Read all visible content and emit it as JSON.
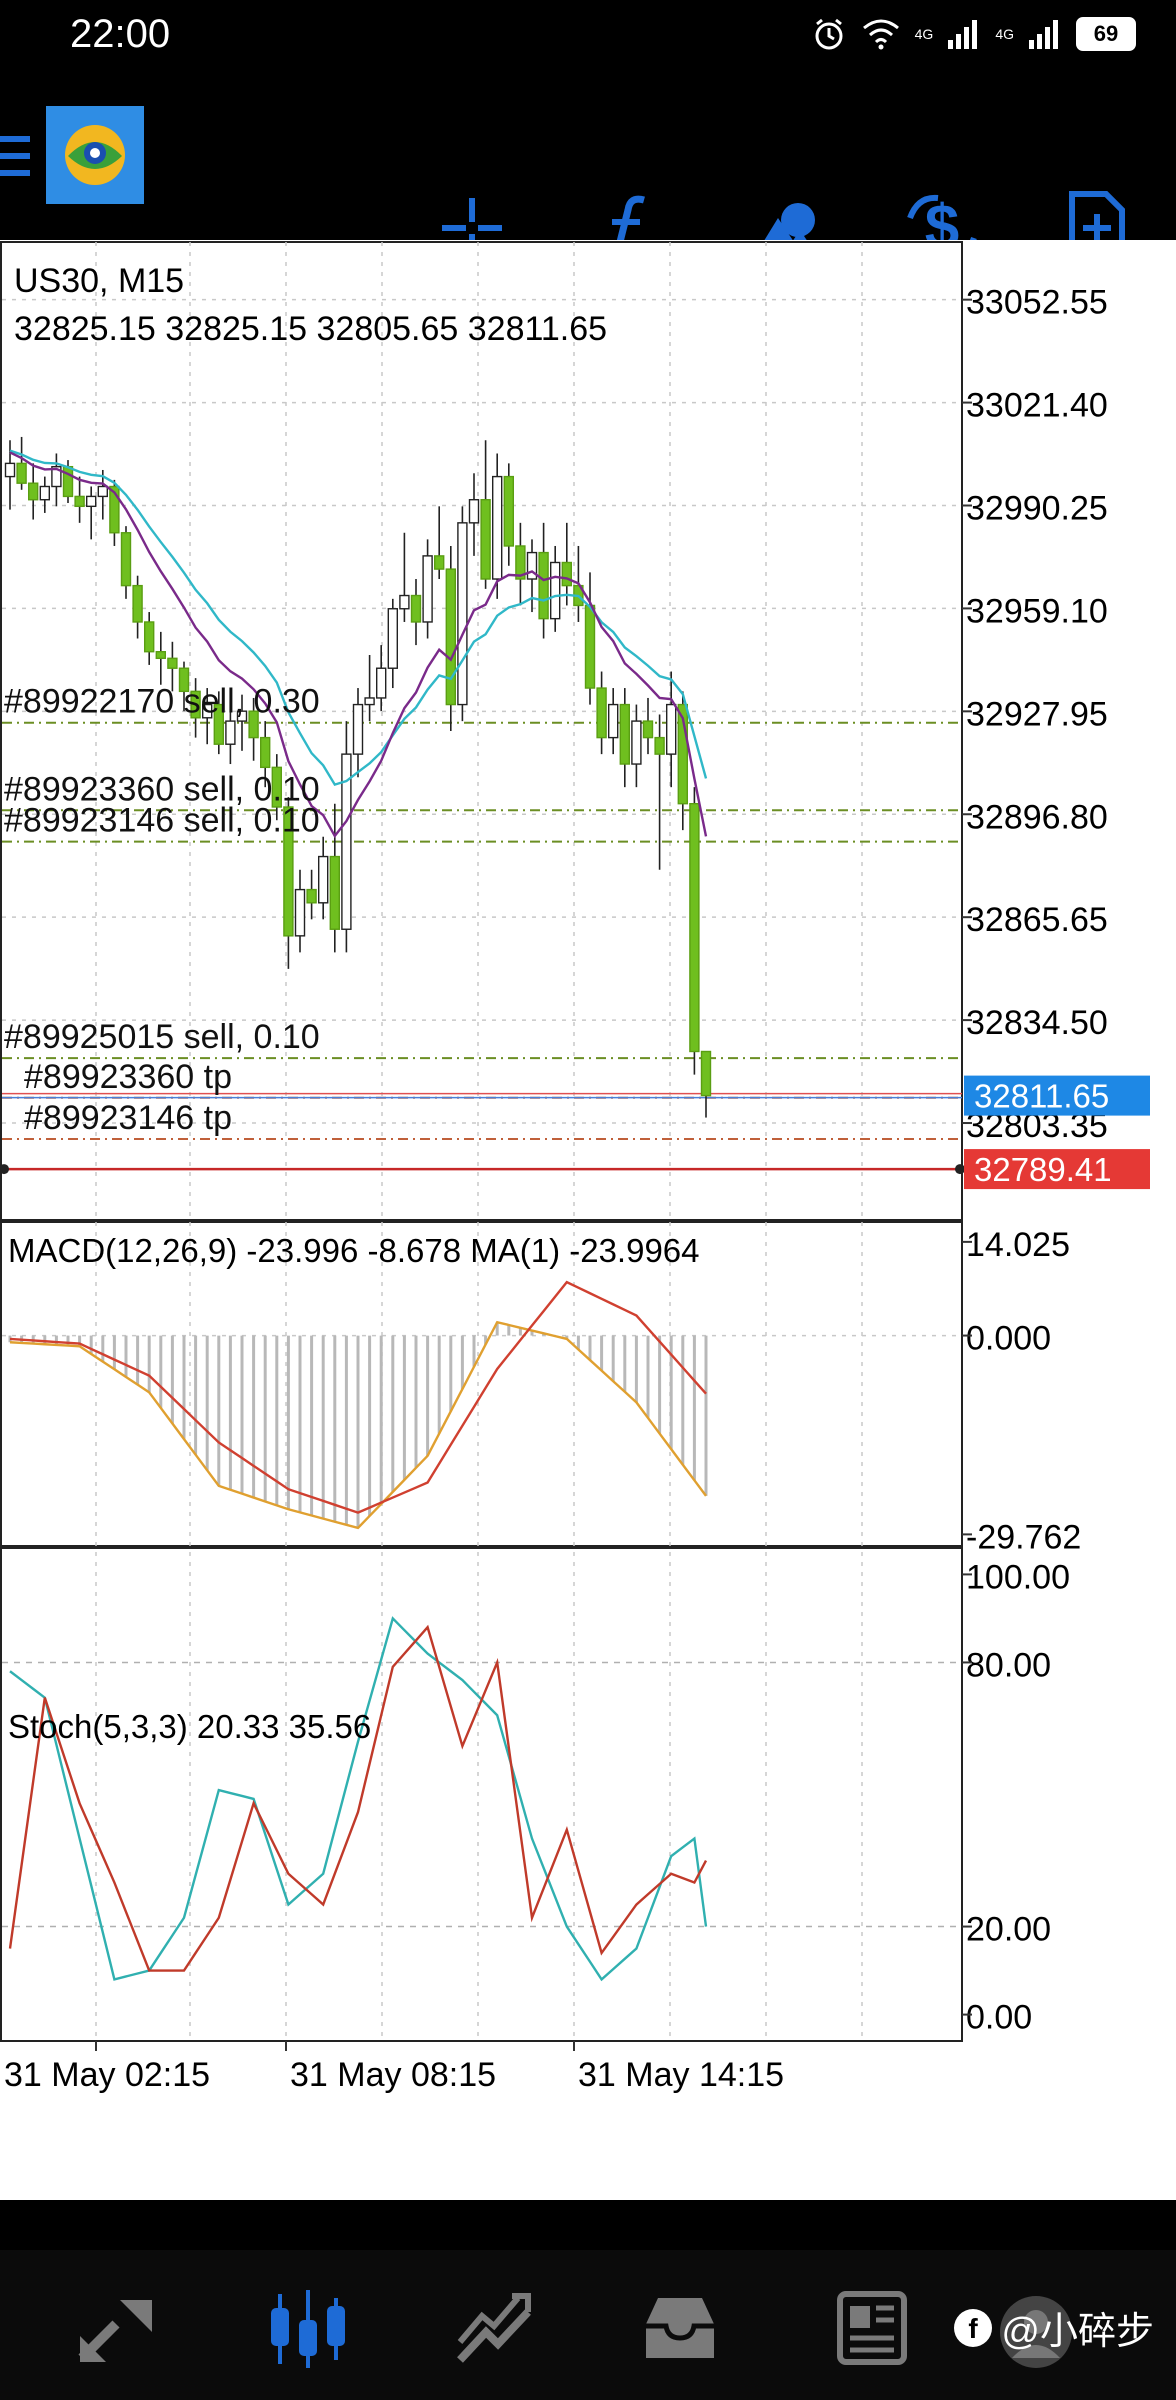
{
  "status": {
    "time": "22:00",
    "battery": "69",
    "net1": "4G",
    "net2": "4G"
  },
  "chart": {
    "symbol_tf": "US30, M15",
    "ohlc": "32825.15 32825.15 32805.65 32811.65"
  },
  "price_axis": [
    "33052.55",
    "33021.40",
    "32990.25",
    "32959.10",
    "32927.95",
    "32896.80",
    "32865.65",
    "32834.50",
    "32803.35"
  ],
  "current_price": {
    "label": "32811.65",
    "color": "#1e88e5"
  },
  "alert_price": {
    "label": "32789.41",
    "color": "#e53935"
  },
  "orders": [
    {
      "label": "#89922170 sell, 0.30",
      "price": 32924.5
    },
    {
      "label": "#89923360 sell, 0.10",
      "price": 32898.0
    },
    {
      "label": "#89923146 sell, 0.10",
      "price": 32888.5
    },
    {
      "label": "#89925015 sell, 0.10",
      "price": 32823.0
    },
    {
      "label": "#89923360 tp",
      "price": 32811.0
    },
    {
      "label": "#89923146 tp",
      "price": 32798.5
    }
  ],
  "macd": {
    "label": "MACD(12,26,9) -23.996 -8.678 MA(1) -23.9964",
    "axis": [
      "14.025",
      "0.000",
      "-29.762"
    ]
  },
  "stoch": {
    "label": "Stoch(5,3,3) 20.33 35.56",
    "axis": [
      "100.00",
      "80.00",
      "20.00",
      "0.00"
    ]
  },
  "time_axis": [
    "31 May 02:15",
    "31 May 08:15",
    "31 May 14:15"
  ],
  "watermark": "@小碎步",
  "chart_data": [
    {
      "type": "candlestick",
      "title": "US30, M15",
      "ylim": [
        32774,
        33070
      ],
      "candles": [
        [
          32999,
          33010,
          32989,
          33003
        ],
        [
          33003,
          33011,
          32995,
          32997
        ],
        [
          32997,
          33003,
          32986,
          32992
        ],
        [
          32992,
          32999,
          32988,
          32996
        ],
        [
          32996,
          33006,
          32990,
          33002
        ],
        [
          33002,
          33004,
          32991,
          32993
        ],
        [
          32993,
          32999,
          32985,
          32990
        ],
        [
          32990,
          32996,
          32980,
          32993
        ],
        [
          32993,
          33001,
          32986,
          32996
        ],
        [
          32996,
          32998,
          32978,
          32982
        ],
        [
          32982,
          32984,
          32962,
          32966
        ],
        [
          32966,
          32969,
          32950,
          32955
        ],
        [
          32955,
          32958,
          32942,
          32946
        ],
        [
          32946,
          32952,
          32936,
          32944
        ],
        [
          32944,
          32949,
          32934,
          32941
        ],
        [
          32941,
          32943,
          32928,
          32934
        ],
        [
          32934,
          32938,
          32920,
          32926
        ],
        [
          32926,
          32935,
          32918,
          32930
        ],
        [
          32930,
          32934,
          32915,
          32918
        ],
        [
          32918,
          32929,
          32912,
          32925
        ],
        [
          32925,
          32933,
          32916,
          32928
        ],
        [
          32928,
          32932,
          32913,
          32920
        ],
        [
          32920,
          32925,
          32905,
          32911
        ],
        [
          32911,
          32915,
          32895,
          32899
        ],
        [
          32899,
          32902,
          32850,
          32860
        ],
        [
          32860,
          32880,
          32855,
          32874
        ],
        [
          32874,
          32880,
          32865,
          32870
        ],
        [
          32870,
          32890,
          32865,
          32884
        ],
        [
          32884,
          32900,
          32855,
          32862
        ],
        [
          32862,
          32925,
          32855,
          32915
        ],
        [
          32915,
          32935,
          32908,
          32930
        ],
        [
          32930,
          32945,
          32925,
          32932
        ],
        [
          32932,
          32948,
          32928,
          32941
        ],
        [
          32941,
          32962,
          32935,
          32959
        ],
        [
          32959,
          32982,
          32955,
          32963
        ],
        [
          32963,
          32968,
          32948,
          32955
        ],
        [
          32955,
          32980,
          32950,
          32975
        ],
        [
          32975,
          32990,
          32968,
          32971
        ],
        [
          32971,
          32978,
          32922,
          32930
        ],
        [
          32930,
          32990,
          32925,
          32985
        ],
        [
          32985,
          33000,
          32975,
          32992
        ],
        [
          32992,
          33010,
          32965,
          32968
        ],
        [
          32968,
          33006,
          32962,
          32999
        ],
        [
          32999,
          33003,
          32972,
          32978
        ],
        [
          32978,
          32985,
          32960,
          32968
        ],
        [
          32968,
          32980,
          32958,
          32976
        ],
        [
          32976,
          32985,
          32950,
          32956
        ],
        [
          32956,
          32978,
          32952,
          32973
        ],
        [
          32973,
          32985,
          32960,
          32966
        ],
        [
          32966,
          32978,
          32955,
          32960
        ],
        [
          32960,
          32970,
          32930,
          32935
        ],
        [
          32935,
          32940,
          32915,
          32920
        ],
        [
          32920,
          32935,
          32915,
          32930
        ],
        [
          32930,
          32935,
          32905,
          32912
        ],
        [
          32912,
          32930,
          32905,
          32925
        ],
        [
          32925,
          32932,
          32915,
          32920
        ],
        [
          32920,
          32927,
          32880,
          32915
        ],
        [
          32915,
          32940,
          32905,
          32930
        ],
        [
          32930,
          32934,
          32892,
          32900
        ],
        [
          32900,
          32905,
          32818,
          32825
        ],
        [
          32825,
          32825,
          32805,
          32811.65
        ]
      ]
    },
    {
      "type": "line",
      "title": "MACD(12,26,9) -23.996 -8.678 MA(1) -23.9964",
      "ylim": [
        -31.5,
        17
      ],
      "x": [
        0,
        6,
        12,
        18,
        24,
        30,
        36,
        42,
        48,
        54,
        60
      ],
      "series": [
        {
          "values": [
            -1.0,
            -1.6,
            -8.5,
            -22.5,
            -26.0,
            -28.8,
            -18.0,
            2.0,
            -0.5,
            -10.0,
            -24.0
          ]
        },
        {
          "values": [
            -0.5,
            -1.2,
            -6.0,
            -16.0,
            -23.0,
            -26.5,
            -22.0,
            -5.0,
            8.0,
            3.0,
            -8.7
          ]
        }
      ]
    },
    {
      "type": "line",
      "title": "Stoch(5,3,3) 20.33 35.56",
      "ylim": [
        -6,
        106
      ],
      "x": [
        0,
        3,
        6,
        9,
        12,
        15,
        18,
        21,
        24,
        27,
        30,
        33,
        36,
        39,
        42,
        45,
        48,
        51,
        54,
        57,
        59,
        60
      ],
      "series": [
        {
          "values": [
            78,
            72,
            40,
            8,
            10,
            22,
            51,
            49,
            25,
            32,
            62,
            90,
            82,
            76,
            68,
            40,
            20,
            8,
            15,
            36,
            40,
            20
          ]
        },
        {
          "values": [
            15,
            72,
            48,
            30,
            10,
            10,
            22,
            48,
            32,
            25,
            46,
            79,
            88,
            61,
            80,
            22,
            42,
            14,
            25,
            32,
            30,
            35
          ]
        }
      ]
    }
  ]
}
